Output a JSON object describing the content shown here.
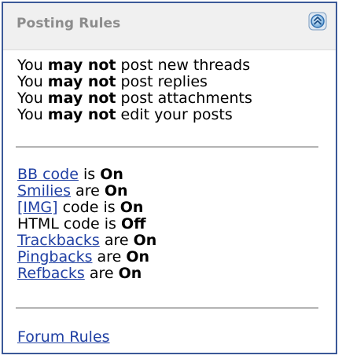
{
  "panel": {
    "title": "Posting Rules",
    "collapse_icon": "collapse-arrows-icon"
  },
  "permissions": [
    {
      "prefix": "You",
      "emphasis": "may not",
      "suffix": "post new threads"
    },
    {
      "prefix": "You",
      "emphasis": "may not",
      "suffix": "post replies"
    },
    {
      "prefix": "You",
      "emphasis": "may not",
      "suffix": "post attachments"
    },
    {
      "prefix": "You",
      "emphasis": "may not",
      "suffix": "edit your posts"
    }
  ],
  "settings": [
    {
      "link": "BB code",
      "text": "is",
      "state": "On"
    },
    {
      "link": "Smilies",
      "text": "are",
      "state": "On"
    },
    {
      "link": "[IMG]",
      "text": "code is",
      "state": "On"
    },
    {
      "label": "HTML code is",
      "state": "Off"
    },
    {
      "link": "Trackbacks",
      "text": "are",
      "state": "On"
    },
    {
      "link": "Pingbacks",
      "text": "are",
      "state": "On"
    },
    {
      "link": "Refbacks",
      "text": "are",
      "state": "On"
    }
  ],
  "footer": {
    "forum_rules_link": "Forum Rules"
  },
  "colors": {
    "border": "#3b5998",
    "header_bg": "#f0f0f0",
    "title": "#8c8c8c",
    "link": "#1f3fa3",
    "divider": "#b4b4b4"
  }
}
